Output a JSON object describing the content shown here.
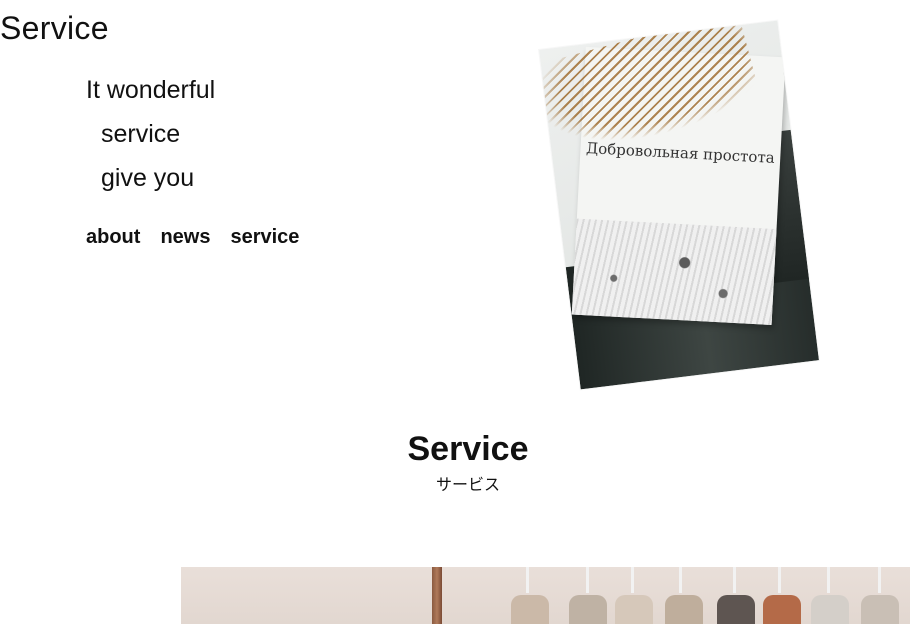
{
  "header": {
    "logo": "Service"
  },
  "tagline": {
    "lines": [
      "It wonderful",
      "service",
      "give you"
    ]
  },
  "nav": {
    "items": [
      "about",
      "news",
      "service"
    ]
  },
  "hero_image": {
    "book_title": "Добровольная простота"
  },
  "section": {
    "title_en": "Service",
    "title_ja": "サービス"
  },
  "colors": {
    "text": "#111111",
    "background": "#ffffff"
  }
}
